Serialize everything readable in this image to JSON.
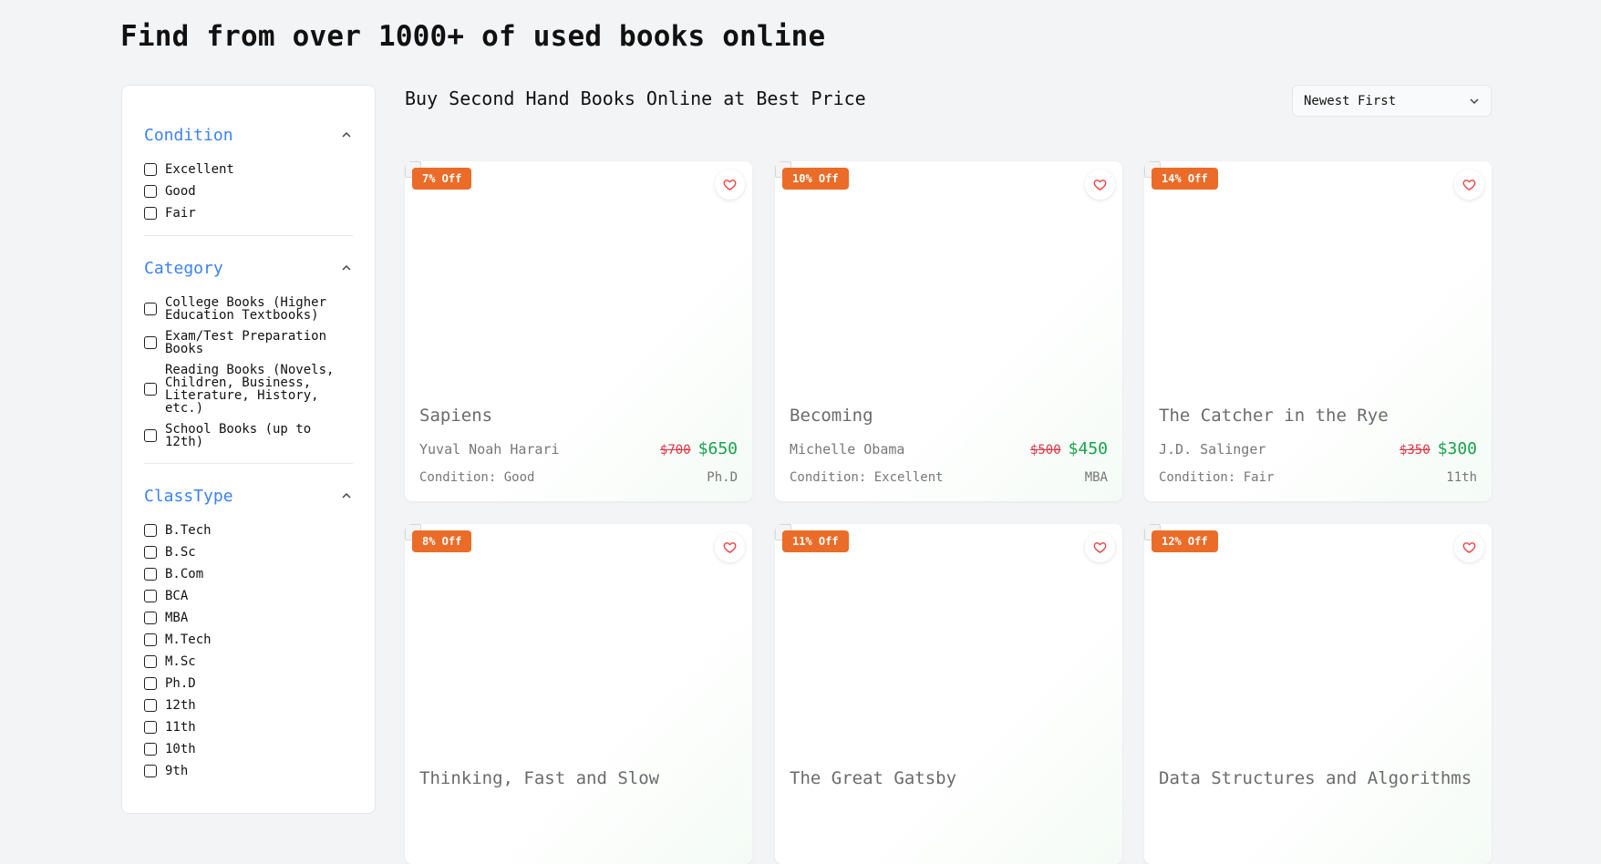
{
  "page_title": "Find from over 1000+ of used books online",
  "main_heading": "Buy Second Hand Books Online at Best Price",
  "sort": {
    "selected": "Newest First"
  },
  "filters": {
    "condition": {
      "title": "Condition",
      "options": [
        "Excellent",
        "Good",
        "Fair"
      ]
    },
    "category": {
      "title": "Category",
      "options": [
        "College Books (Higher\nEducation Textbooks)",
        "Exam/Test Preparation\nBooks",
        "Reading Books (Novels,\nChildren, Business,\nLiterature, History,\netc.)",
        "School Books (up to\n12th)"
      ]
    },
    "classtype": {
      "title": "ClassType",
      "options": [
        "B.Tech",
        "B.Sc",
        "B.Com",
        "BCA",
        "MBA",
        "M.Tech",
        "M.Sc",
        "Ph.D",
        "12th",
        "11th",
        "10th",
        "9th"
      ]
    }
  },
  "books": [
    {
      "badge": "7% Off",
      "title": "Sapiens",
      "author": "Yuval Noah Harari",
      "old_price": "$700",
      "price": "$650",
      "condition": "Condition: Good",
      "class": "Ph.D"
    },
    {
      "badge": "10% Off",
      "title": "Becoming",
      "author": "Michelle Obama",
      "old_price": "$500",
      "price": "$450",
      "condition": "Condition: Excellent",
      "class": "MBA"
    },
    {
      "badge": "14% Off",
      "title": "The Catcher in the Rye",
      "author": "J.D. Salinger",
      "old_price": "$350",
      "price": "$300",
      "condition": "Condition: Fair",
      "class": "11th"
    },
    {
      "badge": "8% Off",
      "title": "Thinking, Fast and Slow"
    },
    {
      "badge": "11% Off",
      "title": "The Great Gatsby"
    },
    {
      "badge": "12% Off",
      "title": "Data Structures and Algorithms"
    }
  ],
  "colors": {
    "accent": "#3b82f6",
    "badge": "#ea6c28",
    "price_new": "#16a34a",
    "price_old": "#dc3545",
    "heart": "#ef4444"
  }
}
